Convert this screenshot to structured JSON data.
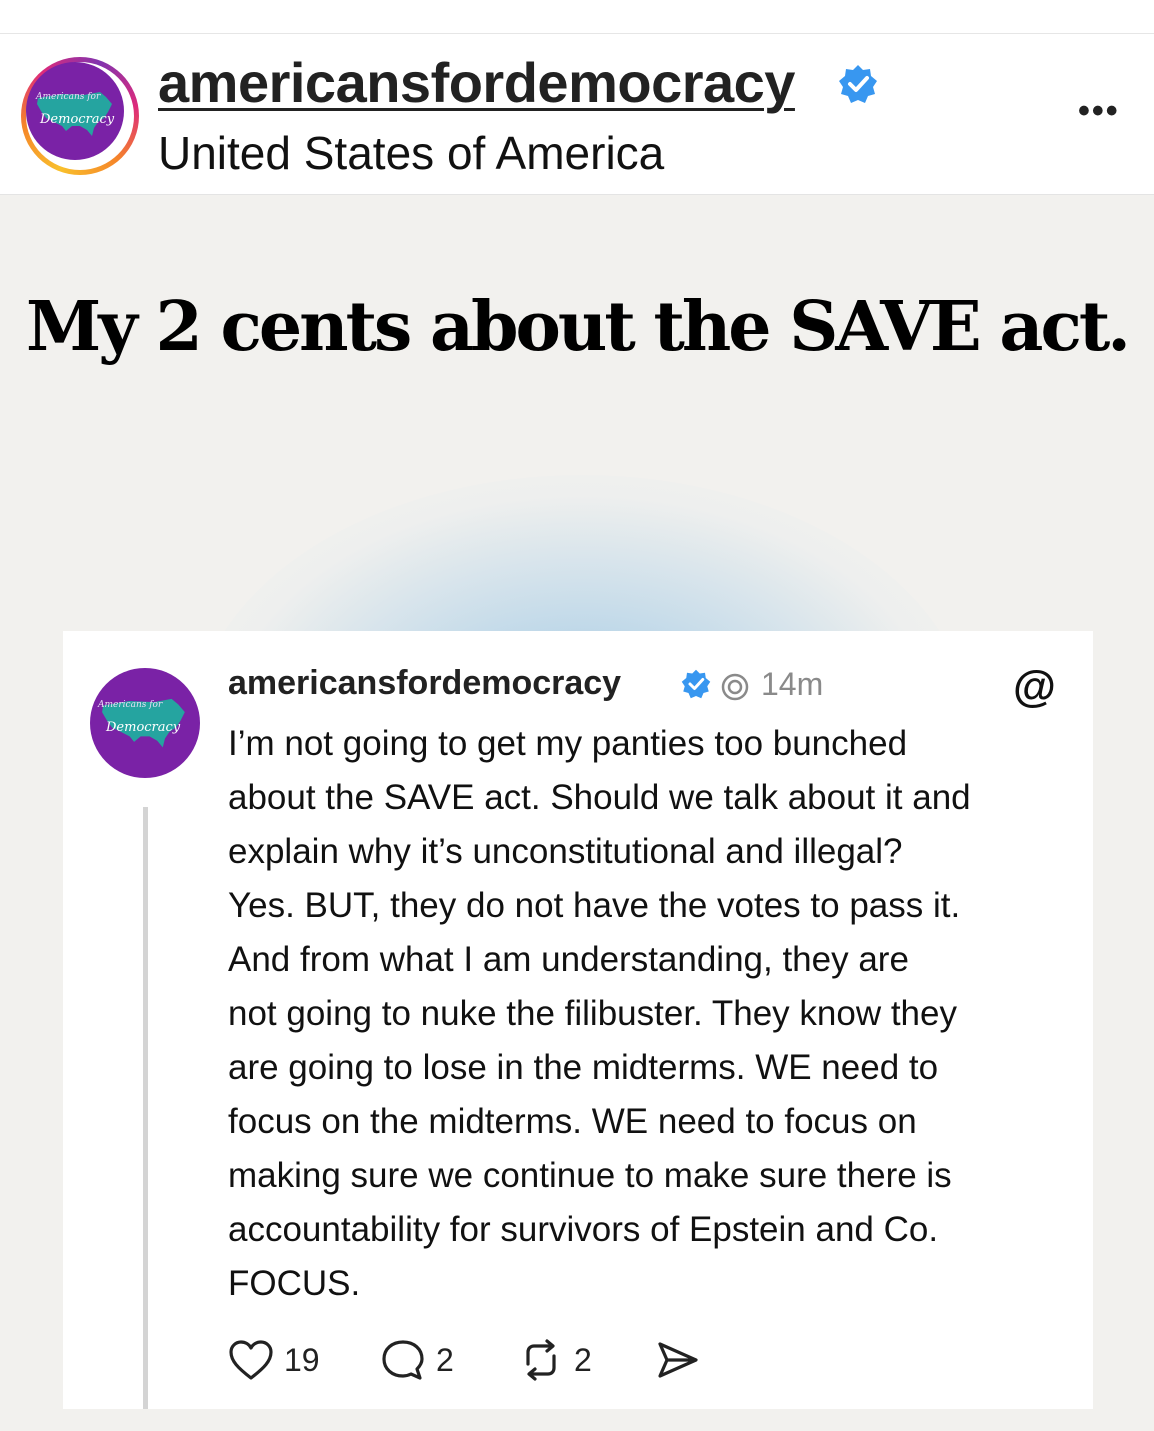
{
  "header": {
    "username": "americansfordemocracy",
    "location": "United States of America",
    "avatar_logo_line1": "Americans for",
    "avatar_logo_line2": "Democracy",
    "verified_icon": "verified-badge-icon",
    "more_icon": "more-options-icon",
    "more_glyph": "•••"
  },
  "post": {
    "headline": "My 2 cents about the SAVE act.",
    "card": {
      "username": "americansfordemocracy",
      "time": "14m",
      "body": "I’m not going to get my panties too bunched\nabout the SAVE act. Should we talk about it and\nexplain why it’s unconstitutional and illegal?\nYes. BUT, they do not have the votes to pass it.\nAnd from what I am understanding, they are\nnot going to nuke the filibuster. They know they\nare going to lose in the midterms. WE need to\nfocus on the midterms. WE need to focus on\nmaking sure we continue to make sure there is\naccountability for survivors of Epstein and Co.\nFOCUS.",
      "threads_logo": "@",
      "actions": {
        "likes": "19",
        "comments": "2",
        "reposts": "2"
      }
    }
  },
  "colors": {
    "brand_purple": "#7a22a6",
    "verified_blue": "#3897f0",
    "post_background": "#f2f1ee",
    "glow_blue": "#96c3e1"
  }
}
